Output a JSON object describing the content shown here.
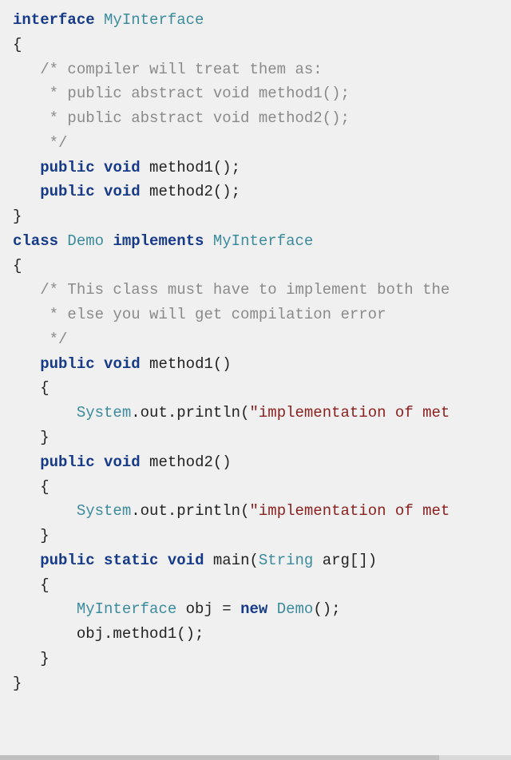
{
  "code": {
    "l1_kw_interface": "interface",
    "l1_type": "MyInterface",
    "l2_brace": "{",
    "l3_cm": "/* compiler will treat them as:",
    "l4_cm": " * public abstract void method1();",
    "l5_cm": " * public abstract void method2();",
    "l6_cm": " */",
    "l7_kw_public": "public",
    "l7_kw_void": "void",
    "l7_rest": " method1();",
    "l8_kw_public": "public",
    "l8_kw_void": "void",
    "l8_rest": " method2();",
    "l9_brace": "}",
    "l10_kw_class": "class",
    "l10_type_demo": "Demo",
    "l10_kw_implements": "implements",
    "l10_type_iface": "MyInterface",
    "l11_brace": "{",
    "l12_cm": "/* This class must have to implement both the ",
    "l13_cm": " * else you will get compilation error",
    "l14_cm": " */",
    "l15_kw_public": "public",
    "l15_kw_void": "void",
    "l15_rest": " method1()",
    "l16_brace": "{",
    "l17_sys": "System",
    "l17_mid": ".out.println(",
    "l17_str": "\"implementation of met",
    "l18_brace": "}",
    "l19_kw_public": "public",
    "l19_kw_void": "void",
    "l19_rest": " method2()",
    "l20_brace": "{",
    "l21_sys": "System",
    "l21_mid": ".out.println(",
    "l21_str": "\"implementation of met",
    "l22_brace": "}",
    "l23_kw_public": "public",
    "l23_kw_static": "static",
    "l23_kw_void": "void",
    "l23_main": " main(",
    "l23_type_string": "String",
    "l23_arg": " arg[])",
    "l24_brace": "{",
    "l25_type_iface": "MyInterface",
    "l25_mid": " obj = ",
    "l25_kw_new": "new",
    "l25_type_demo": " Demo",
    "l25_end": "();",
    "l26": "obj.method1();",
    "l27_brace": "}",
    "l28_brace": "}"
  }
}
